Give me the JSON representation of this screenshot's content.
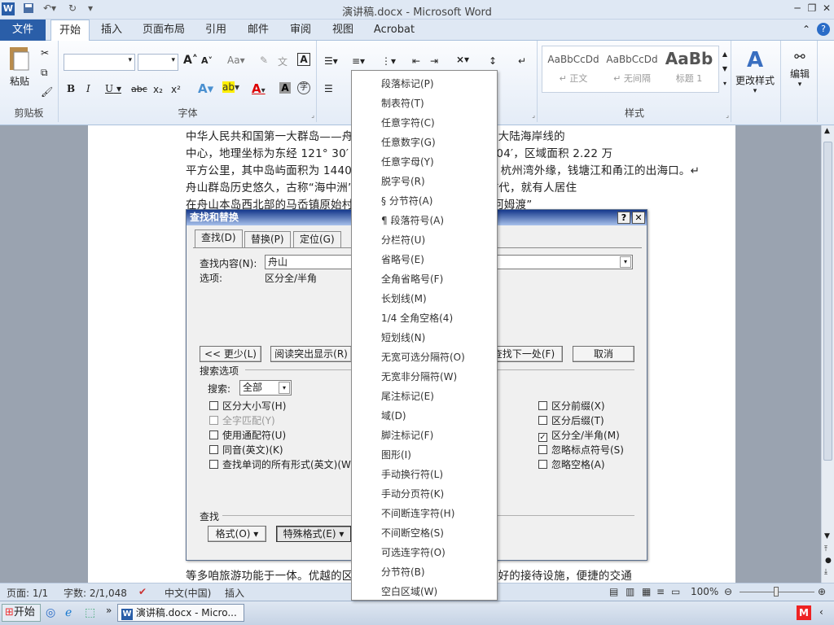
{
  "window": {
    "title": "演讲稿.docx - Microsoft Word",
    "app_icon": "W"
  },
  "ribbon_tabs": [
    "文件",
    "开始",
    "插入",
    "页面布局",
    "引用",
    "邮件",
    "审阅",
    "视图",
    "Acrobat"
  ],
  "ribbon": {
    "clipboard": {
      "paste": "粘贴",
      "label": "剪贴板"
    },
    "font": {
      "label": "字体",
      "bold": "B",
      "italic": "I",
      "underline": "U",
      "strike": "abc",
      "sub": "x₂",
      "sup": "x²",
      "grow": "A",
      "shrink": "A",
      "aa": "Aa",
      "font_color": "A",
      "char_shade": "A",
      "border": "A"
    },
    "styles": {
      "label": "样式",
      "items": [
        {
          "preview": "AaBbCcDd",
          "name": "↵ 正文"
        },
        {
          "preview": "AaBbCcDd",
          "name": "↵ 无间隔"
        },
        {
          "preview": "AaBb",
          "name": "标题 1"
        }
      ],
      "change": "更改样式"
    },
    "editing": {
      "label": "编辑"
    }
  },
  "document": {
    "lines": [
      "中华人民共和国第一大群岛——舟山群岛，位于中华人民共和国大陆海岸线的",
      "中心，地理坐标为东经 121° 30′ ～ 123° 25′，北纬 29° 31′ 04′，区域面积 2.22 万",
      "平方公里，其中岛屿面积为 1440 平方公里，位于长江口以南、杭州湾外缘，钱塘江和甬江的出海口。↵",
      "舟山群岛历史悠久，古称“海中洲”。早在五千多年前的新石器时代，就有人居住",
      "在舟山本岛西北部的马岙镇原始村落，创造了光辉灿烂的“海岛河姆渡”",
      "等多咱旅游功能于一体。优越的区位优势，完善的交通条件，良好的接待设施，便捷的交通"
    ]
  },
  "dialog": {
    "title": "查找和替换",
    "tabs": [
      "查找(D)",
      "替换(P)",
      "定位(G)"
    ],
    "find_label": "查找内容(N):",
    "find_value": "舟山",
    "options_label": "选项:",
    "options_value": "区分全/半角",
    "buttons": {
      "less": "<< 更少(L)",
      "highlight": "阅读突出显示(R)",
      "find_next": "查找下一处(F)",
      "cancel": "取消"
    },
    "search_options": "搜索选项",
    "search_label": "搜索:",
    "search_value": "全部",
    "left_checks": [
      {
        "label": "区分大小写(H)",
        "checked": false,
        "disabled": false
      },
      {
        "label": "全字匹配(Y)",
        "checked": false,
        "disabled": true
      },
      {
        "label": "使用通配符(U)",
        "checked": false,
        "disabled": false
      },
      {
        "label": "同音(英文)(K)",
        "checked": false,
        "disabled": false
      },
      {
        "label": "查找单词的所有形式(英文)(W)",
        "checked": false,
        "disabled": false
      }
    ],
    "right_checks": [
      {
        "label": "区分前缀(X)",
        "checked": false
      },
      {
        "label": "区分后缀(T)",
        "checked": false
      },
      {
        "label": "区分全/半角(M)",
        "checked": true
      },
      {
        "label": "忽略标点符号(S)",
        "checked": false
      },
      {
        "label": "忽略空格(A)",
        "checked": false
      }
    ],
    "find_section": "查找",
    "format_btn": "格式(O) ▾",
    "special_btn": "特殊格式(E) ▾"
  },
  "special_menu": [
    "段落标记(P)",
    "制表符(T)",
    "任意字符(C)",
    "任意数字(G)",
    "任意字母(Y)",
    "脱字号(R)",
    "§ 分节符(A)",
    "¶ 段落符号(A)",
    "分栏符(U)",
    "省略号(E)",
    "全角省略号(F)",
    "长划线(M)",
    "1/4 全角空格(4)",
    "短划线(N)",
    "无宽可选分隔符(O)",
    "无宽非分隔符(W)",
    "尾注标记(E)",
    "域(D)",
    "脚注标记(F)",
    "图形(I)",
    "手动换行符(L)",
    "手动分页符(K)",
    "不间断连字符(H)",
    "不间断空格(S)",
    "可选连字符(O)",
    "分节符(B)",
    "空白区域(W)"
  ],
  "status": {
    "page": "页面: 1/1",
    "words": "字数: 2/1,048",
    "lang": "中文(中国)",
    "mode": "插入",
    "zoom": "100%"
  },
  "taskbar": {
    "start": "开始",
    "task": "演讲稿.docx - Micro..."
  }
}
